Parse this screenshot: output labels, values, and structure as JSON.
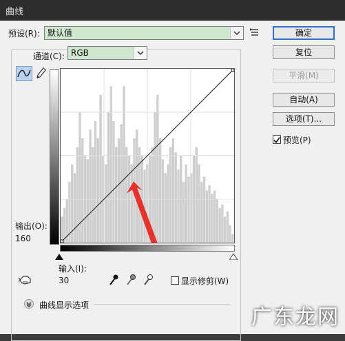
{
  "window": {
    "title": "曲线"
  },
  "preset": {
    "label": "预设(R):",
    "value": "默认值"
  },
  "channel": {
    "label": "通道(C):",
    "value": "RGB"
  },
  "buttons": {
    "ok": "确定",
    "reset": "复位",
    "smooth": "平滑(M)",
    "auto": "自动(A)",
    "options": "选项(T)..."
  },
  "preview": {
    "label": "预览(P)",
    "checked": true
  },
  "output": {
    "label": "输出(O):",
    "value": "160"
  },
  "input": {
    "label": "输入(I):",
    "value": "30"
  },
  "show_clipping": {
    "label": "显示修剪(W)",
    "checked": false
  },
  "curve_display_options": {
    "label": "曲线显示选项"
  },
  "watermark": "广东龙网",
  "histogram_levels": [
    0.15,
    0.2,
    0.25,
    0.35,
    0.45,
    0.4,
    0.55,
    0.75,
    0.6,
    0.5,
    0.48,
    0.65,
    0.55,
    0.7,
    0.6,
    0.85,
    0.5,
    0.45,
    0.75,
    0.9,
    0.7,
    0.55,
    0.6,
    0.68,
    0.9,
    0.55,
    0.5,
    0.45,
    0.6,
    0.65,
    0.55,
    0.5,
    0.42,
    0.45,
    0.5,
    0.55,
    0.75,
    0.85,
    0.6,
    0.48,
    0.4,
    0.45,
    0.55,
    0.6,
    0.52,
    0.42,
    0.5,
    0.35,
    0.45,
    0.38,
    0.4,
    0.5,
    0.55,
    0.45,
    0.35,
    0.38,
    0.3,
    0.33,
    0.28,
    0.3,
    0.25,
    0.2,
    0.22,
    0.15,
    0.18,
    0.1,
    0.05
  ]
}
